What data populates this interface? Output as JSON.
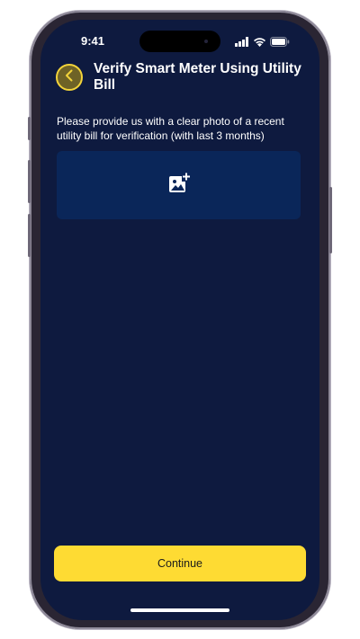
{
  "status_bar": {
    "time": "9:41",
    "icons": [
      "signal-icon",
      "wifi-icon",
      "battery-icon"
    ]
  },
  "header": {
    "back_icon": "chevron-left-icon",
    "title": "Verify Smart Meter Using Utility Bill"
  },
  "main": {
    "description": "Please provide us with a clear photo of a recent utility bill for verification (with last 3 months)",
    "upload_icon": "add-photo-icon"
  },
  "footer": {
    "continue_label": "Continue"
  },
  "colors": {
    "background": "#0e1a3f",
    "upload_area": "#0a2659",
    "accent": "#fedb33",
    "back_button_fill": "#6e6226"
  }
}
